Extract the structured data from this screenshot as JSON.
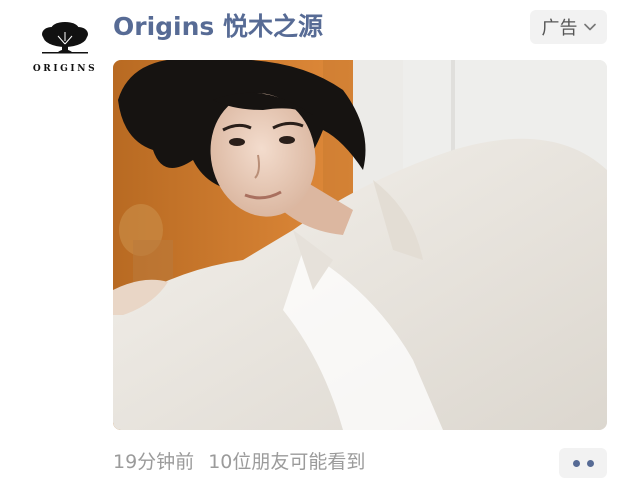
{
  "account": {
    "logo_icon": "oak-tree-logo-icon",
    "logo_text": "ORIGINS",
    "name": "Origins 悦木之源"
  },
  "ad_tag": {
    "label": "广告",
    "icon": "chevron-down-icon"
  },
  "post": {
    "image": "portrait-photo-man-white-suit",
    "time": "19分钟前",
    "friends_seen": "10位朋友可能看到"
  },
  "more_button": {
    "icon": "more-dots-icon"
  },
  "colors": {
    "link_blue": "#576b95",
    "meta_gray": "#9b9b9b",
    "tag_bg": "#f2f2f2"
  }
}
